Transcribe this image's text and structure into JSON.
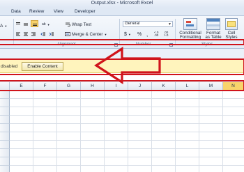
{
  "window": {
    "title": "Output.xlsx - Microsoft Excel"
  },
  "menu": {
    "tabs": [
      "Data",
      "Review",
      "View",
      "Developer"
    ]
  },
  "ribbon": {
    "wrap_text": "Wrap Text",
    "merge_center": "Merge & Center",
    "number_format": "General",
    "currency_symbol": "$",
    "percent_symbol": "%",
    "comma_symbol": ",",
    "conditional_formatting": "Conditional",
    "conditional_formatting_sub": "Formatting",
    "format_as_table": "Format",
    "format_as_table_sub": "as Table",
    "cell_styles": "Cell",
    "cell_styles_sub": "Styles",
    "groups": {
      "alignment": "Alignment",
      "number": "Number",
      "styles": "Styles"
    }
  },
  "message_bar": {
    "text": "disabled",
    "button": "Enable Content"
  },
  "grid": {
    "columns": [
      "E",
      "F",
      "G",
      "H",
      "I",
      "J",
      "K",
      "L",
      "M",
      "N"
    ],
    "selected_column": "N"
  },
  "annotation_color": "#d0141b"
}
